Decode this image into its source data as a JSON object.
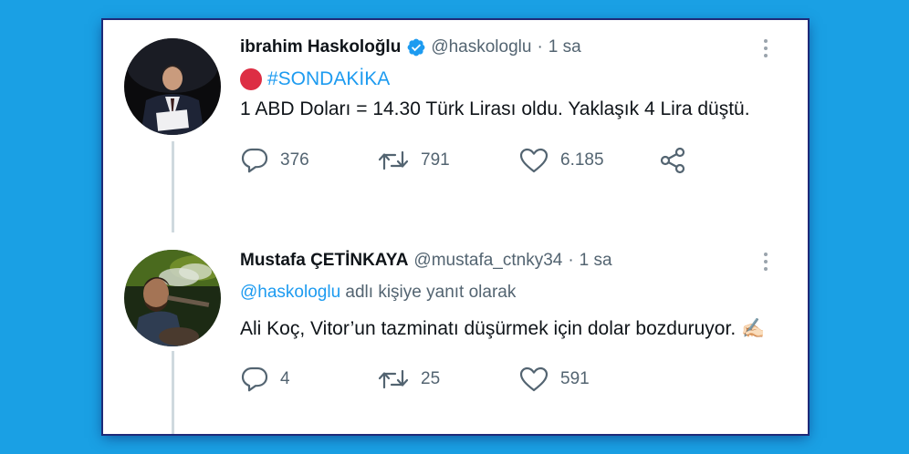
{
  "colors": {
    "background": "#1aa0e4",
    "card": "#ffffff",
    "accent_link": "#1d9bf0",
    "secondary_text": "#536471",
    "verified_badge": "#1d9bf0",
    "red_circle": "#dd2e44"
  },
  "tweets": [
    {
      "name": "ibrahim Haskoloğlu",
      "verified": true,
      "handle": "@haskologlu",
      "separator": "·",
      "time": "1 sa",
      "hashtag": "#SONDAKİKA",
      "text": "1 ABD Doları = 14.30 Türk Lirası oldu. Yaklaşık 4 Lira düştü.",
      "actions": {
        "replies": "376",
        "retweets": "791",
        "likes": "6.185"
      },
      "icons": [
        "reply-icon",
        "retweet-icon",
        "like-icon",
        "share-icon",
        "more-icon",
        "verified-icon",
        "red-circle-emoji"
      ]
    },
    {
      "name": "Mustafa ÇETİNKAYA",
      "handle": "@mustafa_ctnky34",
      "separator": "·",
      "time": "1 sa",
      "reply_to_handle": "@haskologlu",
      "reply_to_suffix": "adlı kişiye yanıt olarak",
      "text": "Ali Koç, Vitor’un tazminatı düşürmek için dolar bozduruyor.",
      "emoji": "✍🏻",
      "actions": {
        "replies": "4",
        "retweets": "25",
        "likes": "591"
      },
      "icons": [
        "reply-icon",
        "retweet-icon",
        "like-icon",
        "more-icon",
        "writing-hand-emoji"
      ]
    }
  ]
}
